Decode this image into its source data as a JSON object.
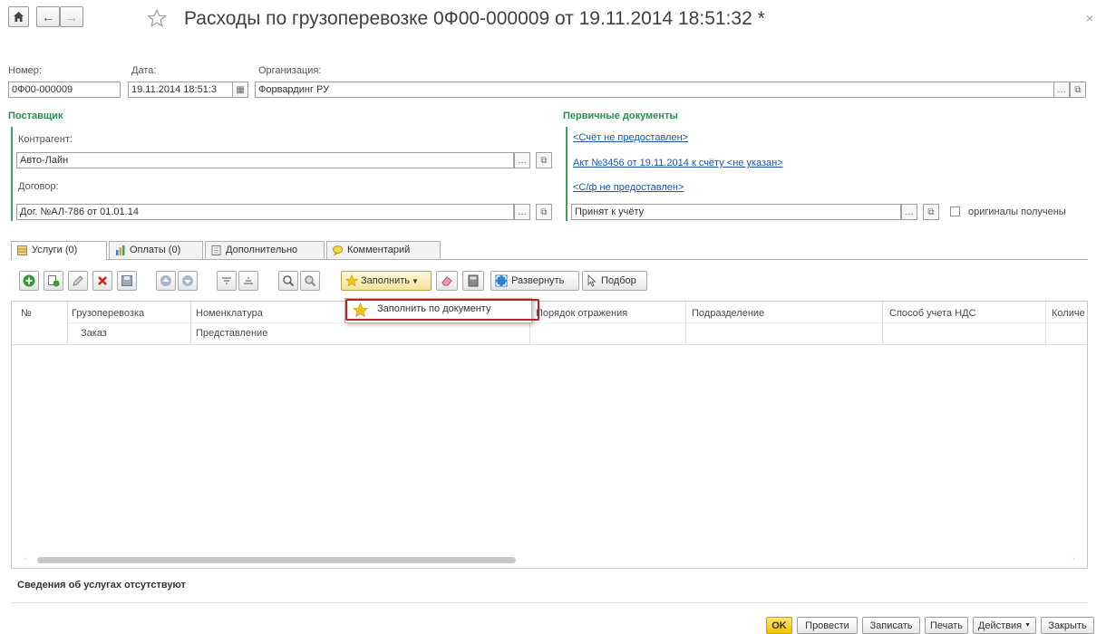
{
  "window": {
    "title": "Расходы по грузоперевозке 0Ф00-000009 от 19.11.2014 18:51:32 *",
    "close_glyph": "×"
  },
  "header": {
    "number_label": "Номер:",
    "number_value": "0Ф00-000009",
    "date_label": "Дата:",
    "date_value": "19.11.2014 18:51:3",
    "org_label": "Организация:",
    "org_value": "Форвардинг РУ"
  },
  "supplier": {
    "section_title": "Поставщик",
    "contractor_label": "Контрагент:",
    "contractor_value": "Авто-Лайн",
    "contract_label": "Договор:",
    "contract_value": "Дог. №АЛ-786 от 01.01.14"
  },
  "primary_docs": {
    "section_title": "Первичные документы",
    "link_invoice": "<Счёт не предоставлен>",
    "link_act": "Акт №3456 от 19.11.2014  к счёту <не указан>",
    "link_vat": "<С/ф не предоставлен>",
    "status_value": "Принят к учёту",
    "originals_label": "оригиналы получены"
  },
  "tabs": [
    {
      "label": "Услуги (0)"
    },
    {
      "label": "Оплаты (0)"
    },
    {
      "label": "Дополнительно"
    },
    {
      "label": "Комментарий"
    }
  ],
  "toolbar": {
    "fill_label": "Заполнить",
    "expand_label": "Развернуть",
    "pick_label": "Подбор"
  },
  "dropdown": {
    "item_label": "Заполнить по документу"
  },
  "grid": {
    "columns": [
      "№",
      "Грузоперевозка",
      "Номенклатура",
      "Порядок отражения",
      "Подразделение",
      "Способ учета НДС",
      "Количе"
    ],
    "subcolumns": [
      "Заказ",
      "Представление"
    ]
  },
  "footer": {
    "status_text": "Сведения об услугах отсутствуют",
    "ok_label": "OK",
    "post_label": "Провести",
    "save_label": "Записать",
    "print_label": "Печать",
    "actions_label": "Действия",
    "close_label": "Закрыть"
  },
  "colors": {
    "section_green": "#2c8c4c",
    "link_blue": "#1a55a8",
    "ok_yellow": "#f2c300",
    "highlight_red": "#c02020"
  }
}
